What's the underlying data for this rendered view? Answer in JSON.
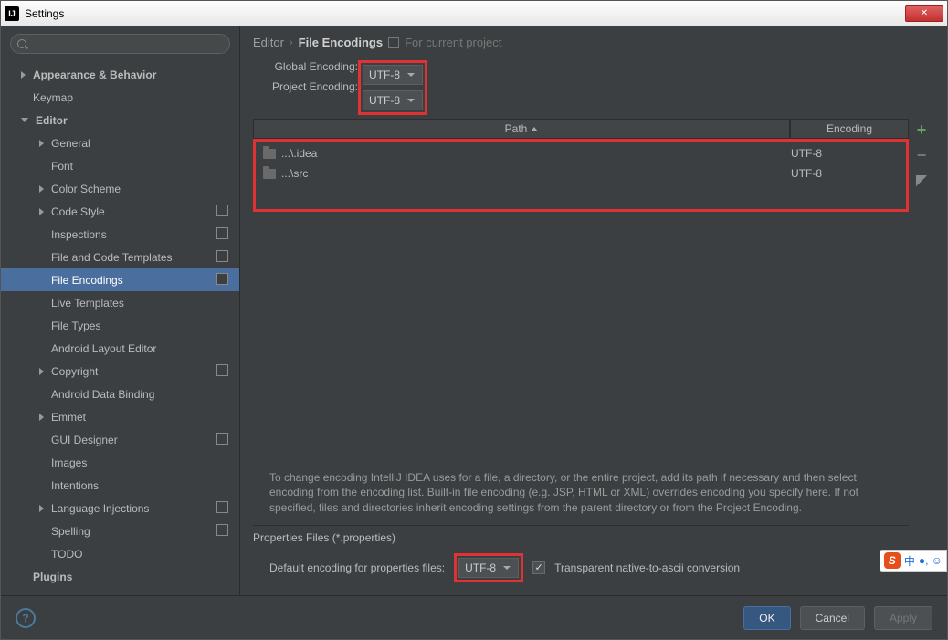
{
  "window": {
    "title": "Settings",
    "app_icon_text": "IJ"
  },
  "search": {
    "placeholder": ""
  },
  "sidebar": {
    "items": [
      {
        "label": "Appearance & Behavior",
        "lvl": 1,
        "bold": true,
        "arrow": "right"
      },
      {
        "label": "Keymap",
        "lvl": 1,
        "bold": false,
        "arrow": "none"
      },
      {
        "label": "Editor",
        "lvl": 1,
        "bold": true,
        "arrow": "down"
      },
      {
        "label": "General",
        "lvl": 2,
        "bold": false,
        "arrow": "right"
      },
      {
        "label": "Font",
        "lvl": 2,
        "bold": false,
        "arrow": "none"
      },
      {
        "label": "Color Scheme",
        "lvl": 2,
        "bold": false,
        "arrow": "right"
      },
      {
        "label": "Code Style",
        "lvl": 2,
        "bold": false,
        "arrow": "right",
        "copy": true
      },
      {
        "label": "Inspections",
        "lvl": 2,
        "bold": false,
        "arrow": "none",
        "copy": true
      },
      {
        "label": "File and Code Templates",
        "lvl": 2,
        "bold": false,
        "arrow": "none",
        "copy": true
      },
      {
        "label": "File Encodings",
        "lvl": 2,
        "bold": false,
        "arrow": "none",
        "copy": true,
        "selected": true
      },
      {
        "label": "Live Templates",
        "lvl": 2,
        "bold": false,
        "arrow": "none"
      },
      {
        "label": "File Types",
        "lvl": 2,
        "bold": false,
        "arrow": "none"
      },
      {
        "label": "Android Layout Editor",
        "lvl": 2,
        "bold": false,
        "arrow": "none"
      },
      {
        "label": "Copyright",
        "lvl": 2,
        "bold": false,
        "arrow": "right",
        "copy": true
      },
      {
        "label": "Android Data Binding",
        "lvl": 2,
        "bold": false,
        "arrow": "none"
      },
      {
        "label": "Emmet",
        "lvl": 2,
        "bold": false,
        "arrow": "right"
      },
      {
        "label": "GUI Designer",
        "lvl": 2,
        "bold": false,
        "arrow": "none",
        "copy": true
      },
      {
        "label": "Images",
        "lvl": 2,
        "bold": false,
        "arrow": "none"
      },
      {
        "label": "Intentions",
        "lvl": 2,
        "bold": false,
        "arrow": "none"
      },
      {
        "label": "Language Injections",
        "lvl": 2,
        "bold": false,
        "arrow": "right",
        "copy": true
      },
      {
        "label": "Spelling",
        "lvl": 2,
        "bold": false,
        "arrow": "none",
        "copy": true
      },
      {
        "label": "TODO",
        "lvl": 2,
        "bold": false,
        "arrow": "none"
      },
      {
        "label": "Plugins",
        "lvl": 1,
        "bold": true,
        "arrow": "none"
      }
    ]
  },
  "breadcrumb": {
    "c1": "Editor",
    "c2": "File Encodings",
    "c3": "For current project"
  },
  "fields": {
    "global_label": "Global Encoding:",
    "global_value": "UTF-8",
    "project_label": "Project Encoding:",
    "project_value": "UTF-8"
  },
  "table": {
    "col_path": "Path",
    "col_enc": "Encoding",
    "rows": [
      {
        "path": "...\\.idea",
        "enc": "UTF-8"
      },
      {
        "path": "...\\src",
        "enc": "UTF-8"
      }
    ]
  },
  "info": "To change encoding IntelliJ IDEA uses for a file, a directory, or the entire project, add its path if necessary and then select encoding from the encoding list. Built-in file encoding (e.g. JSP, HTML or XML) overrides encoding you specify here. If not specified, files and directories inherit encoding settings from the parent directory or from the Project Encoding.",
  "props": {
    "section": "Properties Files (*.properties)",
    "label": "Default encoding for properties files:",
    "value": "UTF-8",
    "checkbox_label": "Transparent native-to-ascii conversion"
  },
  "buttons": {
    "ok": "OK",
    "cancel": "Cancel",
    "apply": "Apply"
  },
  "ime": {
    "s": "S",
    "txt": "中"
  }
}
